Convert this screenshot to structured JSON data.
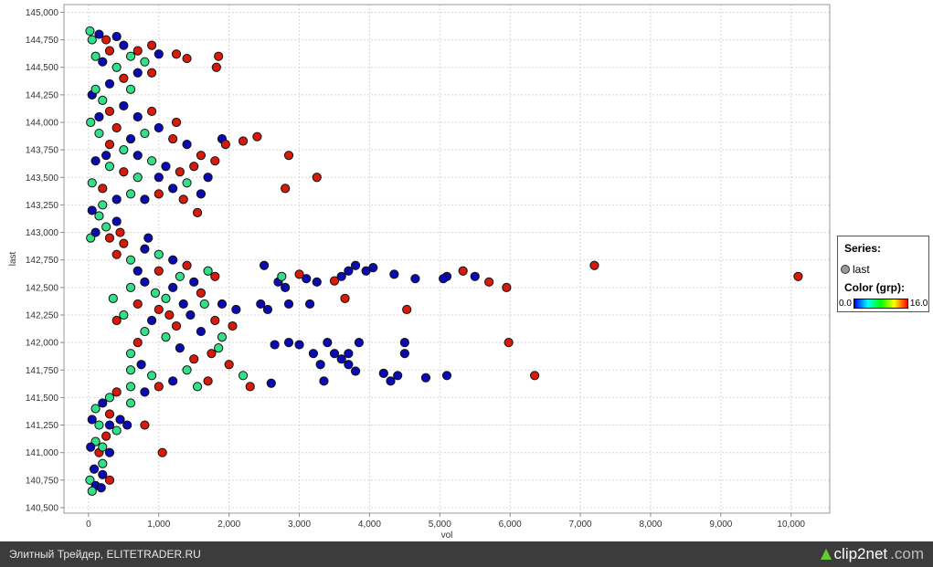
{
  "chart_data": {
    "type": "scatter",
    "xlabel": "vol",
    "ylabel": "last",
    "xlim": [
      -350,
      10550
    ],
    "ylim": [
      140450,
      145070
    ],
    "xticks": [
      0,
      1000,
      2000,
      3000,
      4000,
      5000,
      6000,
      7000,
      8000,
      9000,
      10000
    ],
    "yticks": [
      140500,
      140750,
      141000,
      141250,
      141500,
      141750,
      142000,
      142250,
      142500,
      142750,
      143000,
      143250,
      143500,
      143750,
      144000,
      144250,
      144500,
      144750,
      145000
    ],
    "grid": true,
    "legend": {
      "position": "right",
      "series_title": "Series:",
      "series": [
        "last"
      ],
      "color_title": "Color (grp):",
      "color_min": "0.0",
      "color_max": "16.0"
    },
    "color_scale": [
      "#0000ff",
      "#00ffff",
      "#00ff00",
      "#ffff00",
      "#ff0000"
    ],
    "group_colors": {
      "low": "#0a0ab4",
      "mid": "#33e08a",
      "high": "#d81a0a"
    },
    "points_format": [
      "vol",
      "last",
      "grp"
    ],
    "points": [
      [
        10100,
        142600,
        16
      ],
      [
        7200,
        142700,
        16
      ],
      [
        6350,
        141700,
        16
      ],
      [
        5980,
        142000,
        16
      ],
      [
        5950,
        142500,
        16
      ],
      [
        5700,
        142550,
        16
      ],
      [
        5330,
        142650,
        16
      ],
      [
        5100,
        142600,
        1
      ],
      [
        5050,
        142580,
        1
      ],
      [
        5100,
        141700,
        1
      ],
      [
        4800,
        141680,
        1
      ],
      [
        5500,
        142600,
        1
      ],
      [
        4650,
        142580,
        1
      ],
      [
        4350,
        142620,
        1
      ],
      [
        4500,
        142000,
        1
      ],
      [
        4500,
        141900,
        1
      ],
      [
        4530,
        142300,
        16
      ],
      [
        4400,
        141700,
        1
      ],
      [
        4300,
        141650,
        1
      ],
      [
        4200,
        141720,
        1
      ],
      [
        4050,
        142680,
        1
      ],
      [
        3950,
        142650,
        1
      ],
      [
        3800,
        142700,
        1
      ],
      [
        3700,
        142650,
        1
      ],
      [
        3600,
        142600,
        1
      ],
      [
        3500,
        142560,
        16
      ],
      [
        3650,
        142400,
        16
      ],
      [
        3800,
        141740,
        1
      ],
      [
        3700,
        141900,
        1
      ],
      [
        3600,
        141850,
        1
      ],
      [
        3500,
        141900,
        1
      ],
      [
        3400,
        142000,
        1
      ],
      [
        3300,
        141800,
        1
      ],
      [
        3200,
        141900,
        1
      ],
      [
        3000,
        141980,
        1
      ],
      [
        2850,
        142000,
        1
      ],
      [
        2650,
        141980,
        1
      ],
      [
        2600,
        141630,
        1
      ],
      [
        3250,
        142550,
        1
      ],
      [
        3100,
        142580,
        1
      ],
      [
        3000,
        142620,
        16
      ],
      [
        2800,
        142500,
        1
      ],
      [
        2700,
        142550,
        1
      ],
      [
        2500,
        142700,
        1
      ],
      [
        2450,
        142350,
        1
      ],
      [
        2550,
        142300,
        1
      ],
      [
        2750,
        142600,
        8
      ],
      [
        3150,
        142350,
        1
      ],
      [
        2850,
        142350,
        1
      ],
      [
        3350,
        141650,
        1
      ],
      [
        3850,
        142000,
        1
      ],
      [
        3700,
        141800,
        1
      ],
      [
        2300,
        141600,
        16
      ],
      [
        2200,
        141700,
        8
      ],
      [
        2000,
        141800,
        16
      ],
      [
        1900,
        142350,
        1
      ],
      [
        2100,
        142300,
        1
      ],
      [
        3250,
        143500,
        16
      ],
      [
        2800,
        143400,
        16
      ],
      [
        2850,
        143700,
        16
      ],
      [
        2400,
        143870,
        16
      ],
      [
        2200,
        143830,
        16
      ],
      [
        1900,
        143850,
        1
      ],
      [
        1950,
        143800,
        16
      ],
      [
        1800,
        143650,
        16
      ],
      [
        1600,
        143700,
        16
      ],
      [
        1550,
        143180,
        16
      ],
      [
        1850,
        144600,
        16
      ],
      [
        1820,
        144500,
        16
      ],
      [
        1250,
        144620,
        16
      ],
      [
        1400,
        144580,
        16
      ],
      [
        1250,
        144000,
        16
      ],
      [
        1050,
        141000,
        16
      ],
      [
        800,
        141250,
        16
      ],
      [
        500,
        142900,
        16
      ],
      [
        450,
        143000,
        16
      ],
      [
        300,
        140750,
        16
      ],
      [
        200,
        140800,
        1
      ],
      [
        2050,
        142150,
        16
      ],
      [
        1900,
        142050,
        8
      ],
      [
        1750,
        141900,
        16
      ],
      [
        1600,
        142450,
        16
      ],
      [
        1500,
        142550,
        1
      ],
      [
        1700,
        142650,
        8
      ],
      [
        1800,
        142600,
        16
      ],
      [
        1400,
        142700,
        16
      ],
      [
        1300,
        142600,
        8
      ],
      [
        1200,
        142500,
        1
      ],
      [
        1100,
        142400,
        8
      ],
      [
        1000,
        142300,
        16
      ],
      [
        900,
        142200,
        1
      ],
      [
        800,
        142100,
        8
      ],
      [
        700,
        142000,
        16
      ],
      [
        600,
        141900,
        8
      ],
      [
        750,
        141800,
        1
      ],
      [
        900,
        141700,
        8
      ],
      [
        1000,
        141600,
        16
      ],
      [
        1200,
        141650,
        1
      ],
      [
        1400,
        141750,
        8
      ],
      [
        1500,
        141850,
        16
      ],
      [
        1300,
        141950,
        1
      ],
      [
        1100,
        142050,
        8
      ],
      [
        1250,
        142150,
        16
      ],
      [
        1450,
        142250,
        1
      ],
      [
        1650,
        142350,
        8
      ],
      [
        1350,
        142350,
        1
      ],
      [
        1150,
        142250,
        16
      ],
      [
        950,
        142450,
        8
      ],
      [
        700,
        142350,
        16
      ],
      [
        500,
        142250,
        8
      ],
      [
        400,
        142200,
        16
      ],
      [
        600,
        142500,
        8
      ],
      [
        800,
        142550,
        1
      ],
      [
        1000,
        142650,
        16
      ],
      [
        1200,
        142750,
        1
      ],
      [
        1000,
        142800,
        8
      ],
      [
        800,
        142850,
        1
      ],
      [
        600,
        142750,
        8
      ],
      [
        400,
        142800,
        16
      ],
      [
        700,
        142650,
        1
      ],
      [
        1600,
        142100,
        1
      ],
      [
        1800,
        142200,
        16
      ],
      [
        1700,
        141650,
        16
      ],
      [
        1550,
        141600,
        8
      ],
      [
        600,
        141600,
        8
      ],
      [
        400,
        141550,
        16
      ],
      [
        300,
        141500,
        8
      ],
      [
        200,
        141450,
        1
      ],
      [
        100,
        141400,
        8
      ],
      [
        50,
        141300,
        1
      ],
      [
        150,
        141250,
        8
      ],
      [
        300,
        141250,
        1
      ],
      [
        450,
        141300,
        1
      ],
      [
        550,
        141250,
        1
      ],
      [
        400,
        141200,
        8
      ],
      [
        250,
        141150,
        16
      ],
      [
        100,
        141100,
        8
      ],
      [
        30,
        141050,
        1
      ],
      [
        150,
        141000,
        16
      ],
      [
        300,
        141000,
        1
      ],
      [
        200,
        140900,
        8
      ],
      [
        80,
        140850,
        1
      ],
      [
        20,
        140750,
        8
      ],
      [
        100,
        140700,
        1
      ],
      [
        50,
        140650,
        8
      ],
      [
        180,
        140680,
        1
      ],
      [
        300,
        141350,
        16
      ],
      [
        600,
        141450,
        8
      ],
      [
        800,
        141550,
        1
      ],
      [
        200,
        141050,
        8
      ],
      [
        30,
        142950,
        8
      ],
      [
        100,
        143000,
        1
      ],
      [
        250,
        143050,
        8
      ],
      [
        400,
        143100,
        1
      ],
      [
        300,
        142950,
        16
      ],
      [
        150,
        143150,
        8
      ],
      [
        50,
        143200,
        1
      ],
      [
        200,
        143250,
        8
      ],
      [
        400,
        143300,
        1
      ],
      [
        600,
        143350,
        8
      ],
      [
        800,
        143300,
        1
      ],
      [
        1000,
        143350,
        16
      ],
      [
        1200,
        143400,
        1
      ],
      [
        1400,
        143450,
        8
      ],
      [
        1300,
        143550,
        16
      ],
      [
        1100,
        143600,
        1
      ],
      [
        900,
        143650,
        8
      ],
      [
        700,
        143700,
        1
      ],
      [
        500,
        143750,
        8
      ],
      [
        300,
        143800,
        16
      ],
      [
        600,
        143850,
        1
      ],
      [
        800,
        143900,
        8
      ],
      [
        1000,
        143950,
        1
      ],
      [
        1200,
        143850,
        16
      ],
      [
        1400,
        143800,
        1
      ],
      [
        1500,
        143600,
        16
      ],
      [
        1000,
        143500,
        1
      ],
      [
        700,
        143500,
        8
      ],
      [
        500,
        143550,
        16
      ],
      [
        300,
        143600,
        8
      ],
      [
        100,
        143650,
        1
      ],
      [
        50,
        143450,
        8
      ],
      [
        200,
        143400,
        16
      ],
      [
        1600,
        143350,
        1
      ],
      [
        1700,
        143500,
        1
      ],
      [
        1350,
        143300,
        16
      ],
      [
        30,
        144000,
        8
      ],
      [
        150,
        144050,
        1
      ],
      [
        300,
        144100,
        16
      ],
      [
        500,
        144150,
        1
      ],
      [
        200,
        144200,
        8
      ],
      [
        50,
        144250,
        1
      ],
      [
        100,
        144300,
        8
      ],
      [
        300,
        144350,
        1
      ],
      [
        500,
        144400,
        16
      ],
      [
        700,
        144450,
        1
      ],
      [
        400,
        144500,
        8
      ],
      [
        200,
        144550,
        1
      ],
      [
        100,
        144600,
        8
      ],
      [
        300,
        144650,
        16
      ],
      [
        500,
        144700,
        1
      ],
      [
        700,
        144650,
        16
      ],
      [
        900,
        144700,
        16
      ],
      [
        1000,
        144620,
        1
      ],
      [
        800,
        144550,
        8
      ],
      [
        600,
        144600,
        8
      ],
      [
        50,
        144750,
        8
      ],
      [
        150,
        144800,
        1
      ],
      [
        20,
        144830,
        8
      ],
      [
        250,
        144750,
        16
      ],
      [
        400,
        144780,
        1
      ],
      [
        900,
        144450,
        16
      ],
      [
        600,
        144300,
        8
      ],
      [
        400,
        143950,
        16
      ],
      [
        700,
        144050,
        1
      ],
      [
        900,
        144100,
        16
      ],
      [
        150,
        143900,
        8
      ],
      [
        250,
        143700,
        1
      ],
      [
        850,
        142950,
        1
      ],
      [
        600,
        141750,
        8
      ],
      [
        350,
        142400,
        8
      ],
      [
        1850,
        141950,
        8
      ]
    ]
  },
  "footer": {
    "caption": "Элитный Трейдер, ELITETRADER.RU",
    "logo_main": "clip2net",
    "logo_suffix": ".com"
  }
}
